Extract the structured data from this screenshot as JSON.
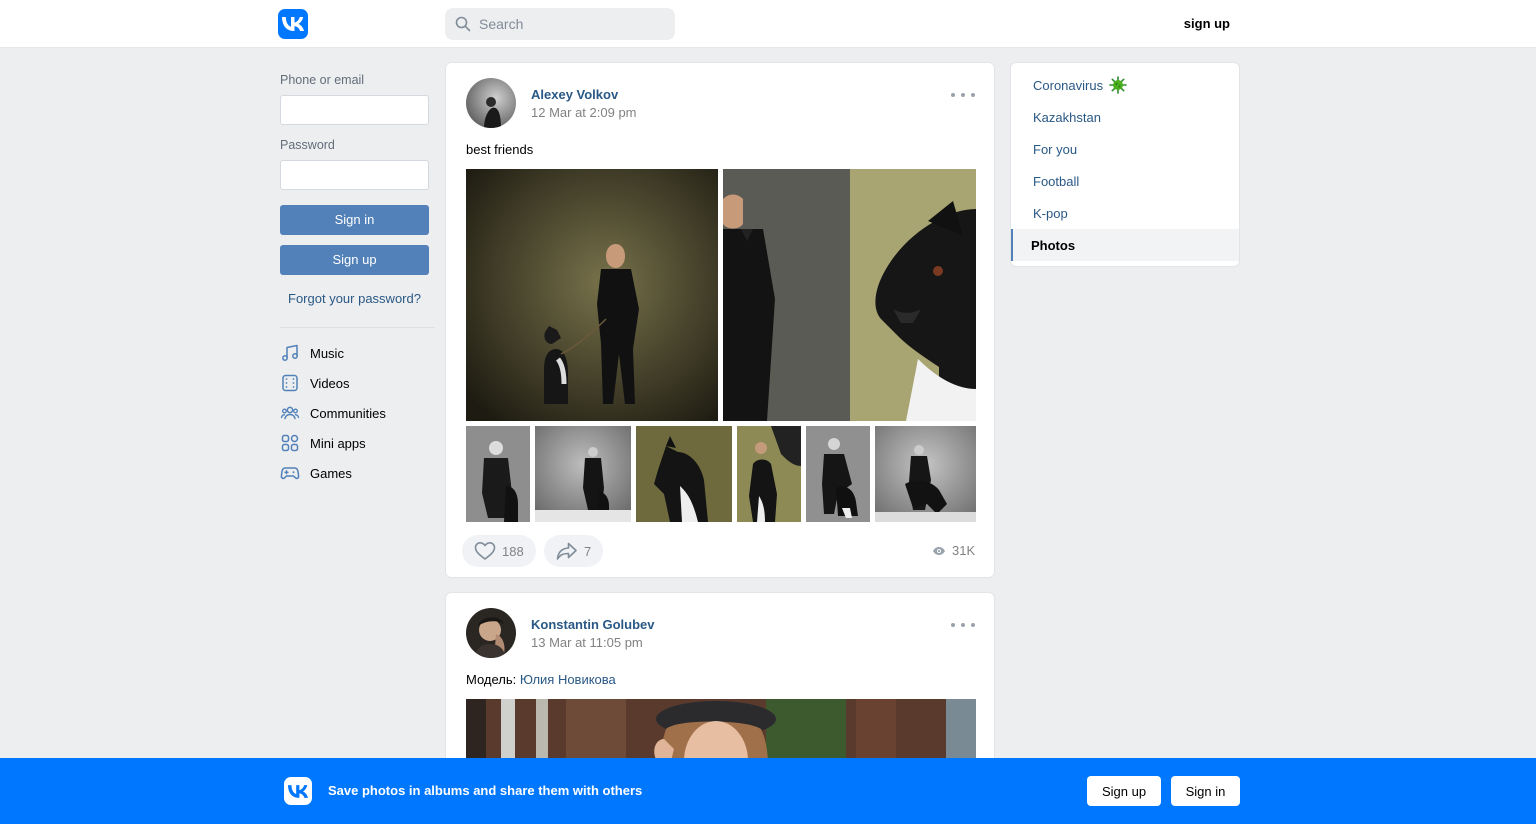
{
  "header": {
    "logo_icon": "vk-logo-icon",
    "search_placeholder": "Search",
    "signup_label": "sign up"
  },
  "login": {
    "phone_label": "Phone or email",
    "phone_value": "",
    "password_label": "Password",
    "password_value": "",
    "signin_label": "Sign in",
    "signup_label": "Sign up",
    "forgot_label": "Forgot your password?"
  },
  "menu": {
    "items": [
      {
        "label": "Music",
        "icon": "music-note-icon"
      },
      {
        "label": "Videos",
        "icon": "film-icon"
      },
      {
        "label": "Communities",
        "icon": "users-icon"
      },
      {
        "label": "Mini apps",
        "icon": "apps-grid-icon"
      },
      {
        "label": "Games",
        "icon": "gamepad-icon"
      }
    ]
  },
  "posts": [
    {
      "author": "Alexey Volkov",
      "time": "12 Mar at 2:09 pm",
      "text": "best friends",
      "likes": "188",
      "shares": "7",
      "views": "31K"
    },
    {
      "author": "Konstantin Golubev",
      "time": "13 Mar at 11:05 pm",
      "text_prefix": "Модель: ",
      "text_link": "Юлия Новикова"
    }
  ],
  "right_nav": {
    "items": [
      {
        "label": "Coronavirus",
        "icon": "virus-icon"
      },
      {
        "label": "Kazakhstan"
      },
      {
        "label": "For you"
      },
      {
        "label": "Football"
      },
      {
        "label": "K-pop"
      },
      {
        "label": "Photos",
        "active": true
      }
    ]
  },
  "banner": {
    "text": "Save photos in albums and share them with others",
    "signup_label": "Sign up",
    "signin_label": "Sign in"
  },
  "colors": {
    "brand": "#0077ff",
    "link": "#2a5885",
    "button": "#5181b8",
    "background": "#edeef0"
  }
}
